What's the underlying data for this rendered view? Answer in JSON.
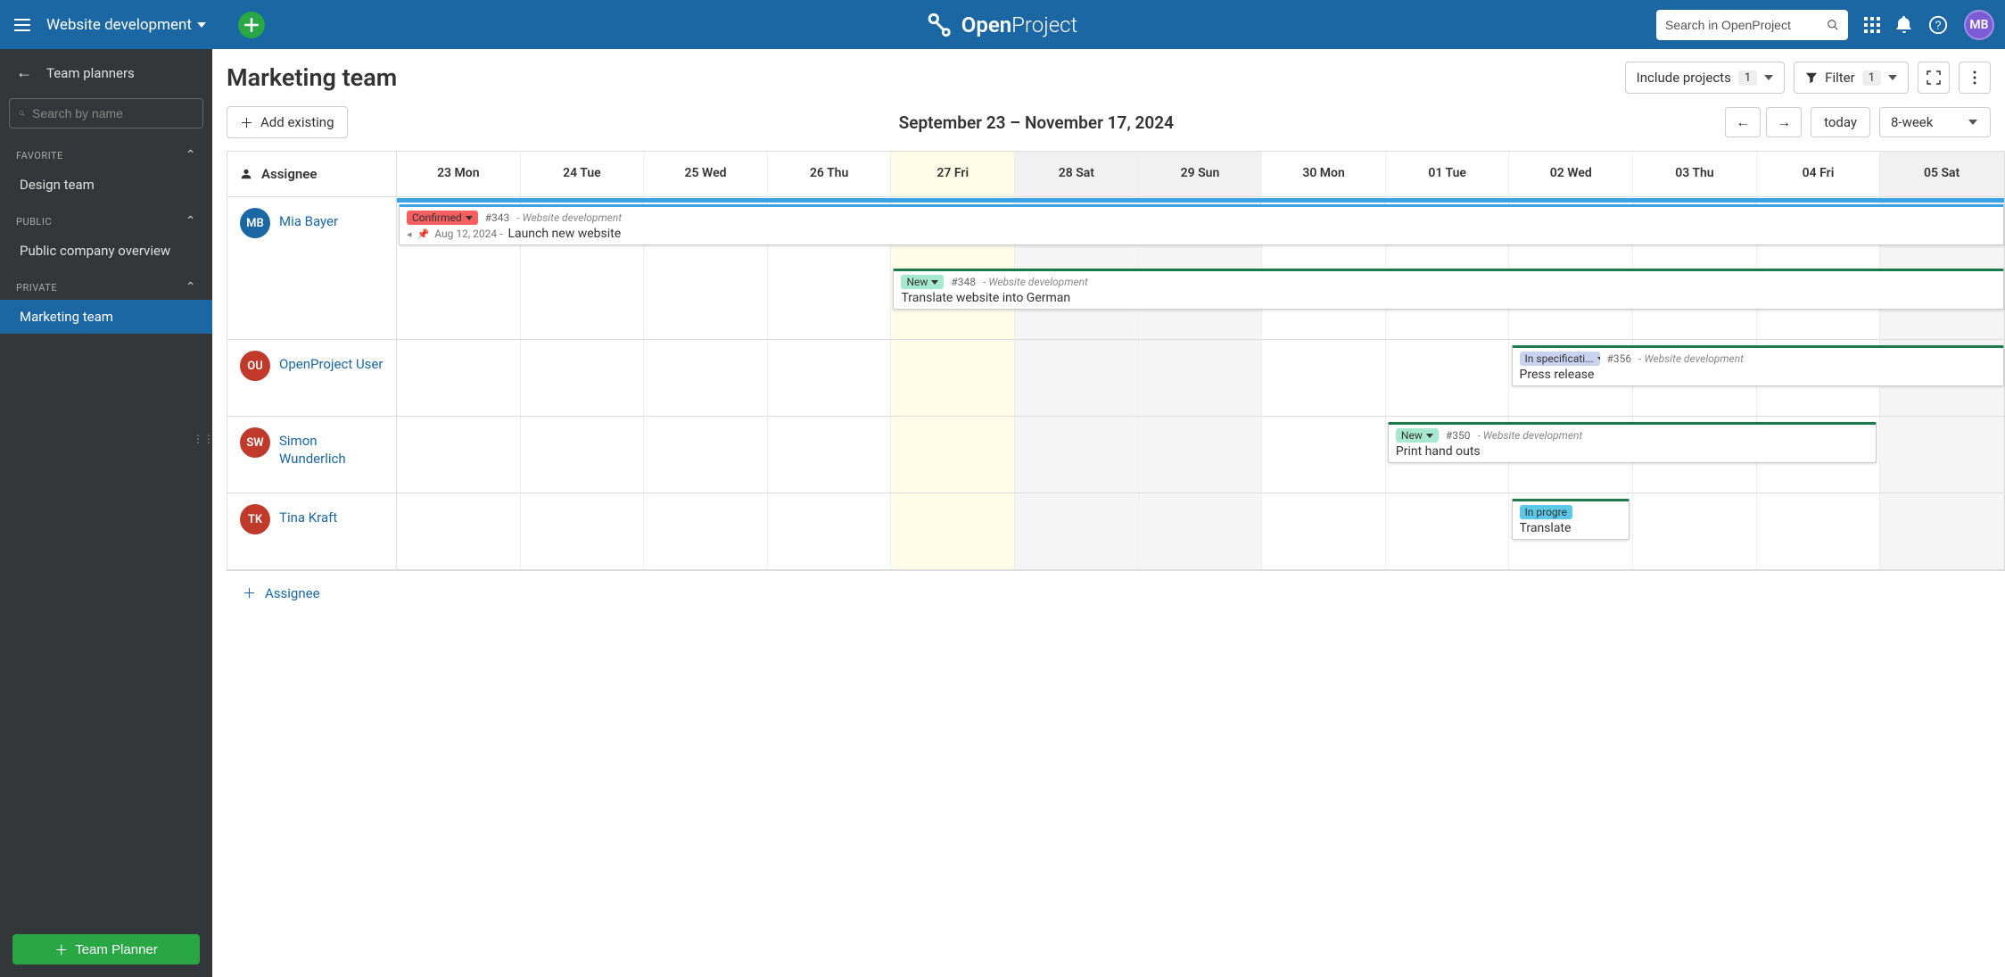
{
  "topbar": {
    "project_name": "Website development",
    "search_placeholder": "Search in OpenProject",
    "avatar_initials": "MB",
    "logo_bold": "Open",
    "logo_light": "Project"
  },
  "sidebar": {
    "back_title": "Team planners",
    "search_placeholder": "Search by name",
    "sections": {
      "favorite": "FAVORITE",
      "public": "PUBLIC",
      "private": "PRIVATE"
    },
    "items": {
      "design": "Design team",
      "public_overview": "Public company overview",
      "marketing": "Marketing team"
    },
    "footer_button": "Team Planner"
  },
  "header": {
    "title": "Marketing team",
    "include_projects": "Include projects",
    "include_count": "1",
    "filter_label": "Filter",
    "filter_count": "1"
  },
  "toolbar": {
    "add_existing": "Add existing",
    "date_range": "September 23 – November 17, 2024",
    "today": "today",
    "range": "8-week"
  },
  "grid": {
    "assignee_header": "Assignee",
    "days": [
      {
        "label": "23 Mon",
        "today": false,
        "wkend": false
      },
      {
        "label": "24 Tue",
        "today": false,
        "wkend": false
      },
      {
        "label": "25 Wed",
        "today": false,
        "wkend": false
      },
      {
        "label": "26 Thu",
        "today": false,
        "wkend": false
      },
      {
        "label": "27 Fri",
        "today": true,
        "wkend": false
      },
      {
        "label": "28 Sat",
        "today": false,
        "wkend": true
      },
      {
        "label": "29 Sun",
        "today": false,
        "wkend": true
      },
      {
        "label": "30 Mon",
        "today": false,
        "wkend": false
      },
      {
        "label": "01 Tue",
        "today": false,
        "wkend": false
      },
      {
        "label": "02 Wed",
        "today": false,
        "wkend": false
      },
      {
        "label": "03 Thu",
        "today": false,
        "wkend": false
      },
      {
        "label": "04 Fri",
        "today": false,
        "wkend": false
      },
      {
        "label": "05 Sat",
        "today": false,
        "wkend": true
      }
    ],
    "assignees": [
      {
        "initials": "MB",
        "name": "Mia Bayer",
        "color": "#1a67a3"
      },
      {
        "initials": "OU",
        "name": "OpenProject User",
        "color": "#c0392b"
      },
      {
        "initials": "SW",
        "name": "Simon Wunderlich",
        "color": "#c0392b"
      },
      {
        "initials": "TK",
        "name": "Tina Kraft",
        "color": "#c0392b"
      }
    ],
    "add_assignee": "Assignee"
  },
  "work_packages": {
    "wp343": {
      "status": "Confirmed",
      "status_bg": "#f55f5f",
      "id": "#343",
      "project": "Website development",
      "date": "Aug 12, 2024",
      "title": "Launch new website",
      "border": "#3aa3e3"
    },
    "wp348": {
      "status": "New",
      "status_bg": "#a7e8d0",
      "id": "#348",
      "project": "Website development",
      "title": "Translate website into German",
      "border": "#1b7a4a"
    },
    "wp356": {
      "status": "In specificati...",
      "status_bg": "#c9d3f0",
      "id": "#356",
      "project": "Website development",
      "title": "Press release",
      "border": "#1b7a4a"
    },
    "wp350": {
      "status": "New",
      "status_bg": "#a7e8d0",
      "id": "#350",
      "project": "Website development",
      "title": "Print hand outs",
      "border": "#1b7a4a"
    },
    "wp_trans": {
      "status": "In progre",
      "status_bg": "#5bc8e8",
      "title": "Translate",
      "border": "#1b7a4a"
    }
  }
}
